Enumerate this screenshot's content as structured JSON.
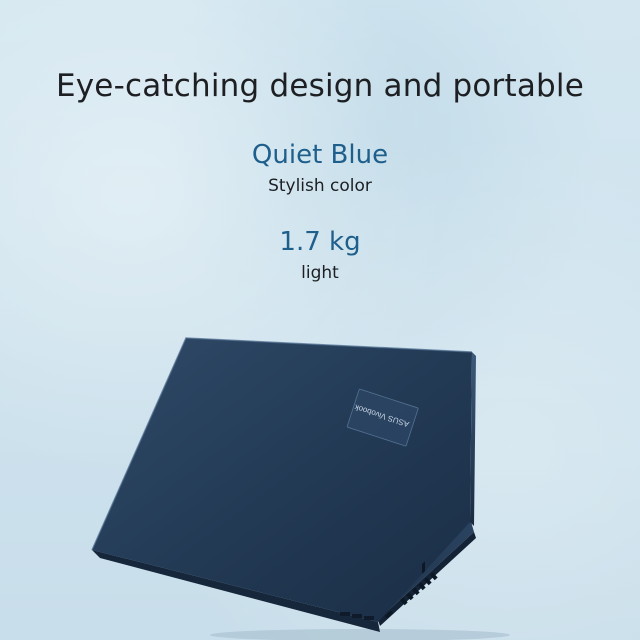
{
  "headline": "Eye-catching design and portable",
  "features": [
    {
      "value": "Quiet Blue",
      "description": "Stylish color"
    },
    {
      "value": "1.7 kg",
      "description": "light"
    }
  ],
  "laptop": {
    "badge_text": "ASUS Vivobook",
    "color": "#1f3550"
  },
  "colors": {
    "accent": "#1f5f8b",
    "background": "#cfe3ee",
    "text": "#1d1f22"
  }
}
